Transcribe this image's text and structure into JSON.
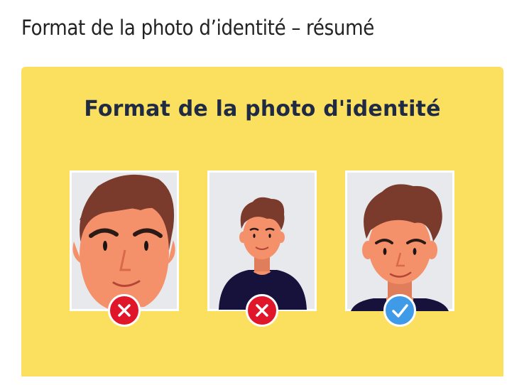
{
  "page": {
    "heading": "Format de la photo d’identité – résumé"
  },
  "infographic": {
    "title": "Format de la photo d'identité",
    "background_color": "#fbdf5e",
    "title_color": "#1f2a44",
    "photos": [
      {
        "framing": "too-close",
        "status": "incorrect",
        "status_icon": "cross-icon",
        "badge_color": "#e0162b"
      },
      {
        "framing": "too-far",
        "status": "incorrect",
        "status_icon": "cross-icon",
        "badge_color": "#e0162b"
      },
      {
        "framing": "correct",
        "status": "correct",
        "status_icon": "check-icon",
        "badge_color": "#3f9be8"
      }
    ]
  },
  "colors": {
    "photo_background": "#e7e9ec",
    "skin": "#f4916b",
    "hair": "#7a3a2c",
    "shirt": "#17123c"
  }
}
